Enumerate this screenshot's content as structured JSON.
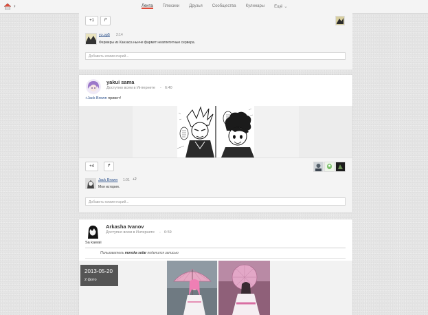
{
  "nav": {
    "items": [
      "Лента",
      "Плюсики",
      "Друзья",
      "Сообщества",
      "Кулинары",
      "Ещё"
    ],
    "active_index": 0
  },
  "post1": {
    "plus_label": "+1",
    "comment": {
      "author": "уэ.эр5",
      "time": "2:14",
      "text": "Фермеры из Канзаса нынче фармят неаппетитные сервера."
    },
    "comment_placeholder": "Добавить комментарий..."
  },
  "post2": {
    "author": "yakui sama",
    "visibility": "Доступно всем в Интернете",
    "time": "6:40",
    "text_mention": "+Jack Brown",
    "text_rest": "привет!",
    "plus_label": "+4",
    "comment": {
      "author": "Jack Brown",
      "time": "1:01",
      "plus": "+2",
      "text": "Моя история."
    },
    "comment_placeholder": "Добавить комментарий..."
  },
  "post3": {
    "author": "Arkasha Ivanov",
    "visibility": "Доступно всем в Интернете",
    "time": "6:59",
    "text": "Sa kawaii",
    "reshare_prefix": "Пользователь",
    "reshare_user": "moroka solar",
    "reshare_suffix": "поделился записью",
    "album_date": "2013-05-20",
    "album_count": "2 фото"
  },
  "colors": {
    "accent_red": "#dd4b39",
    "link_blue": "#2a4f8a",
    "album_overlay": "#555555"
  }
}
